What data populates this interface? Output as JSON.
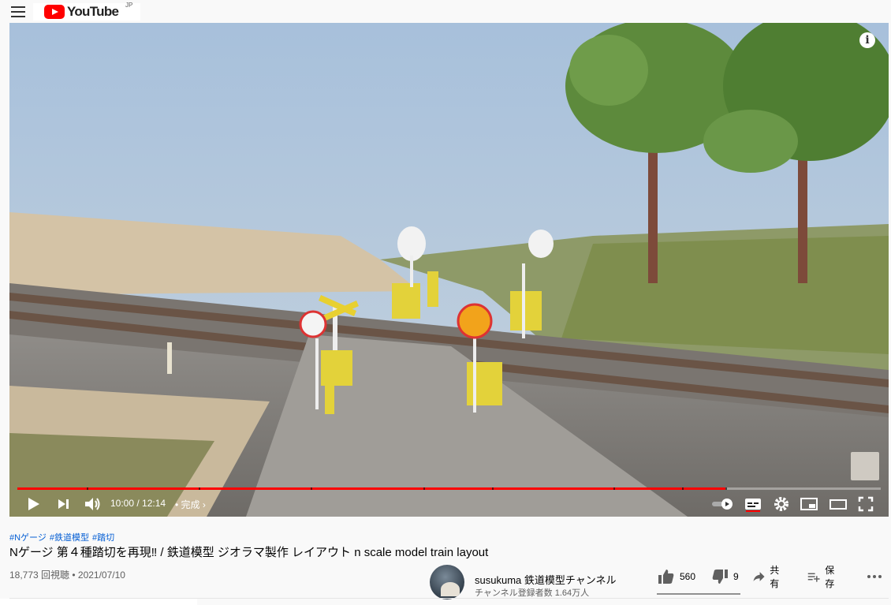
{
  "header": {
    "logo_text": "YouTube",
    "region": "JP",
    "menu_icon": "hamburger-menu-icon"
  },
  "player": {
    "time_display": "10:00 / 12:14",
    "chapter_label": "完成",
    "progress_fraction": 0.82,
    "chapter_markers": [
      0.08,
      0.21,
      0.34,
      0.47,
      0.55,
      0.69,
      0.77,
      0.82
    ]
  },
  "video": {
    "tags": [
      "#Nゲージ",
      "#鉄道模型",
      "#踏切"
    ],
    "title": "Nゲージ 第４種踏切を再現‼ / 鉄道模型 ジオラマ製作 レイアウト n scale model train layout",
    "views_date": "18,773 回視聴 • 2021/07/10"
  },
  "channel": {
    "name": "susukuma 鉄道模型チャンネル",
    "subscribers": "チャンネル登録者数 1.64万人"
  },
  "actions": {
    "like_count": "560",
    "dislike_count": "9",
    "share_label": "共有",
    "save_label": "保存",
    "like_ratio": 0.98
  },
  "colors": {
    "brand_red": "#ff0000",
    "link_blue": "#065fd4",
    "text_primary": "#030303",
    "text_secondary": "#606060"
  }
}
